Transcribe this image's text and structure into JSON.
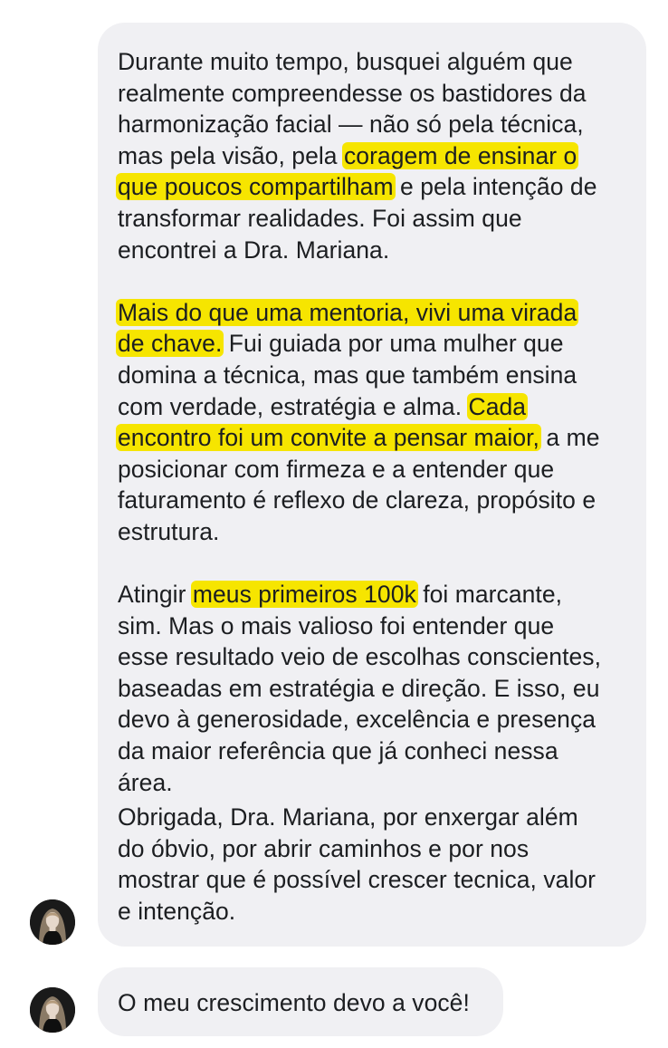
{
  "messages": [
    {
      "paragraphs": [
        {
          "lines": [
            [
              {
                "text": "Durante muito tempo, busquei alguém que"
              }
            ],
            [
              {
                "text": "realmente compreendesse os bastidores da"
              }
            ],
            [
              {
                "text": "harmonização facial — não só pela técnica,"
              }
            ],
            [
              {
                "text": "mas pela visão, pela "
              },
              {
                "text": "coragem de ensinar o",
                "highlight": true
              }
            ],
            [
              {
                "text": "que poucos compartilham",
                "highlight": true
              },
              {
                "text": " e pela intenção de"
              }
            ],
            [
              {
                "text": "transformar realidades. Foi assim que"
              }
            ],
            [
              {
                "text": "encontrei a Dra. Mariana."
              }
            ]
          ]
        },
        {
          "lines": [
            [
              {
                "text": "Mais do que uma mentoria, vivi uma virada",
                "highlight": true
              }
            ],
            [
              {
                "text": "de chave.",
                "highlight": true
              },
              {
                "text": " Fui guiada por uma mulher que"
              }
            ],
            [
              {
                "text": "domina a técnica, mas que também ensina"
              }
            ],
            [
              {
                "text": "com verdade, estratégia e alma. "
              },
              {
                "text": "Cada",
                "highlight": true
              }
            ],
            [
              {
                "text": "encontro foi um convite a pensar maior,",
                "highlight": true
              },
              {
                "text": " a me"
              }
            ],
            [
              {
                "text": "posicionar com firmeza e a entender que"
              }
            ],
            [
              {
                "text": "faturamento é reflexo de clareza, propósito e"
              }
            ],
            [
              {
                "text": "estrutura."
              }
            ]
          ]
        },
        {
          "lines": [
            [
              {
                "text": "Atingir "
              },
              {
                "text": "meus primeiros 100k",
                "highlight": true
              },
              {
                "text": " foi marcante,"
              }
            ],
            [
              {
                "text": "sim. Mas o mais valioso foi entender que"
              }
            ],
            [
              {
                "text": "esse resultado veio de escolhas conscientes,"
              }
            ],
            [
              {
                "text": "baseadas em estratégia e direção. E isso, eu"
              }
            ],
            [
              {
                "text": "devo à generosidade, excelência e presença"
              }
            ],
            [
              {
                "text": "da maior referência que já conheci nessa"
              }
            ],
            [
              {
                "text": "área."
              }
            ]
          ]
        },
        {
          "lines": [
            [
              {
                "text": "Obrigada, Dra. Mariana, por enxergar além"
              }
            ],
            [
              {
                "text": "do óbvio, por abrir caminhos e por nos"
              }
            ],
            [
              {
                "text": "mostrar que é possível crescer tecnica, valor"
              }
            ],
            [
              {
                "text": "e intenção."
              }
            ]
          ]
        }
      ]
    },
    {
      "paragraphs": [
        {
          "lines": [
            [
              {
                "text": "O meu crescimento devo a você!"
              }
            ]
          ]
        }
      ]
    }
  ],
  "colors": {
    "bubble_background": "#f0f0f3",
    "highlight": "#f6e500",
    "text": "#1c1e21"
  },
  "icons": {
    "avatar": "sender-avatar-photo"
  }
}
